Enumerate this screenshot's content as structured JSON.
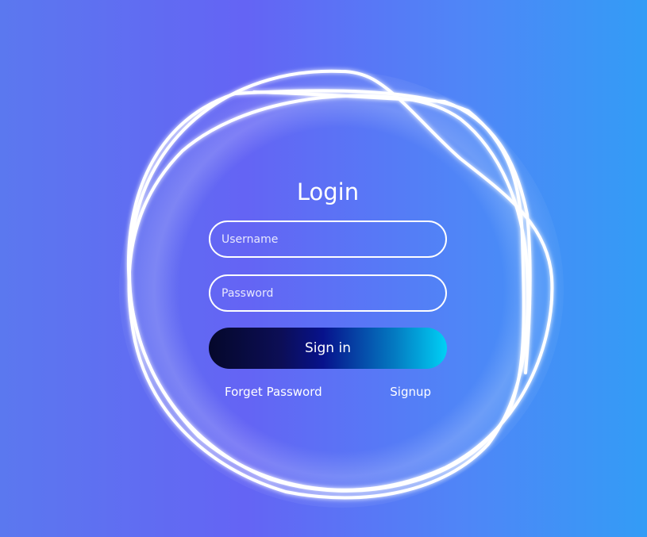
{
  "login": {
    "title": "Login",
    "username_placeholder": "Username",
    "password_placeholder": "Password",
    "signin_label": "Sign in",
    "forget_password_label": "Forget Password",
    "signup_label": "Signup"
  },
  "colors": {
    "background_left": "#5b78ef",
    "background_mid": "#6464f4",
    "background_right": "#339cf6",
    "ring_color": "#ffffff",
    "button_gradient_start": "#05082b",
    "button_gradient_end": "#00d0f5"
  },
  "decor": {
    "ring_icon": "glowing-scribble-rings"
  }
}
